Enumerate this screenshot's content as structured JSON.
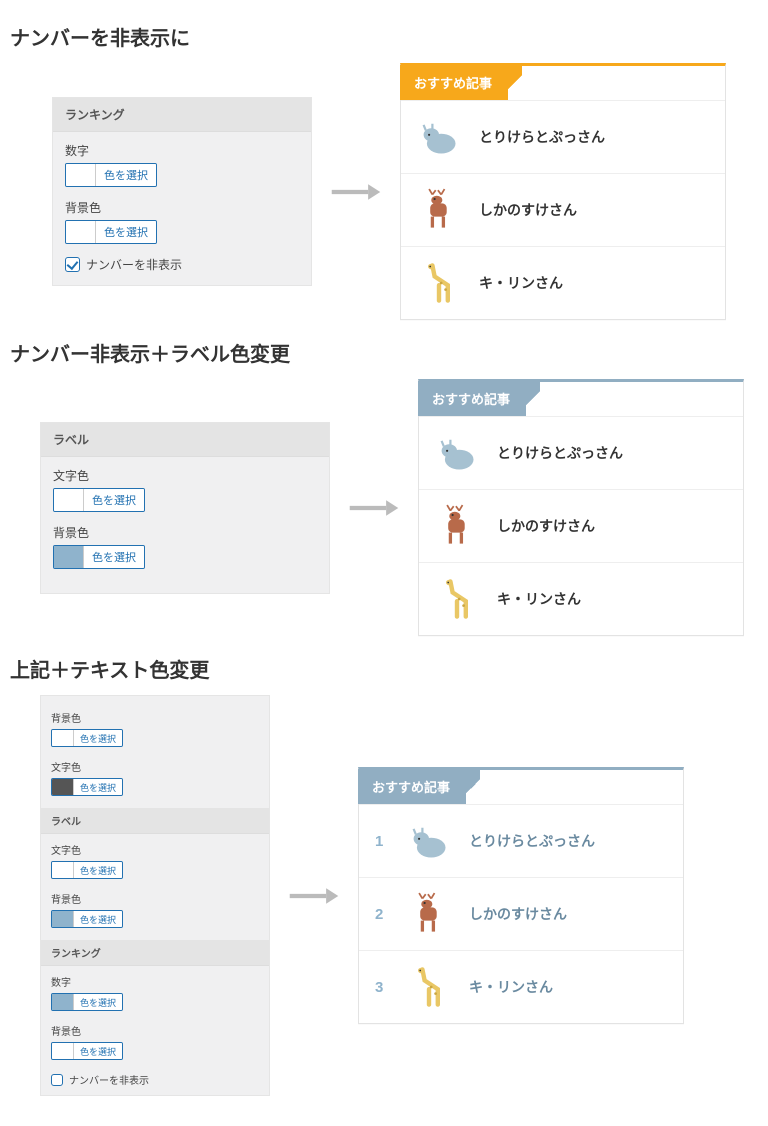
{
  "sections": [
    {
      "title": "ナンバーを非表示に"
    },
    {
      "title": "ナンバー非表示＋ラベル色変更"
    },
    {
      "title": "上記＋テキスト色変更"
    }
  ],
  "panel_labels": {
    "ranking": "ランキング",
    "label": "ラベル",
    "number": "数字",
    "bg": "背景色",
    "text": "文字色",
    "pick": "色を選択",
    "hide_number": "ナンバーを非表示"
  },
  "widget": {
    "tab": "おすすめ記事",
    "items": [
      {
        "num": "1",
        "title": "とりけらとぷっさん",
        "creature": "triceratops",
        "color": "#a6c1d1"
      },
      {
        "num": "2",
        "title": "しかのすけさん",
        "creature": "deer",
        "color": "#b86a4a"
      },
      {
        "num": "3",
        "title": "キ・リンさん",
        "creature": "giraffe",
        "color": "#e9c765"
      }
    ]
  }
}
